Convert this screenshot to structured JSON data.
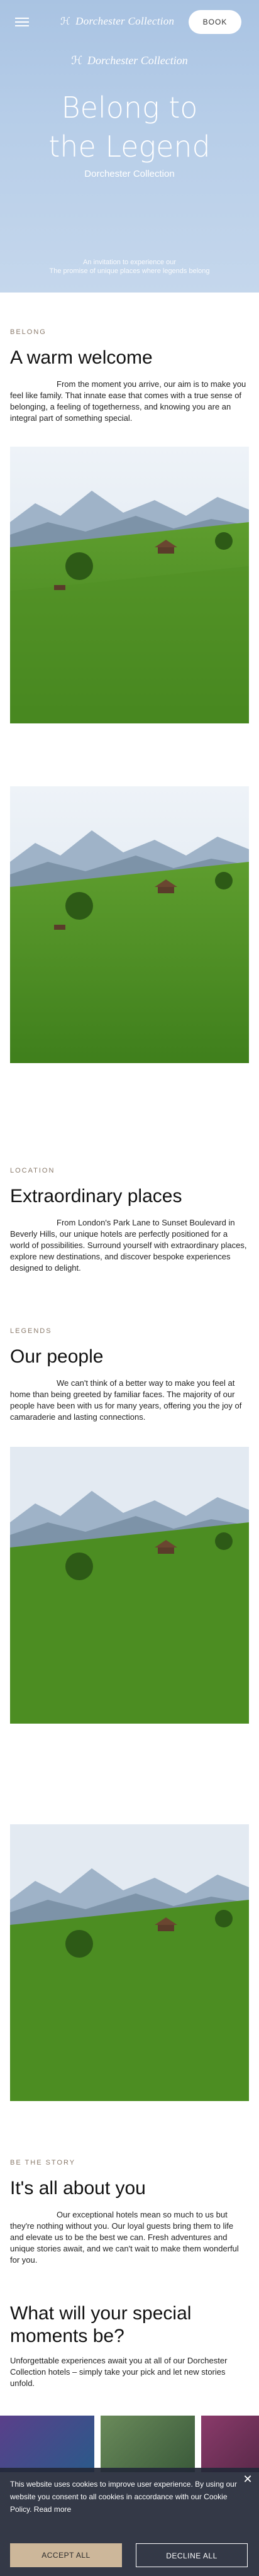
{
  "header": {
    "brand": "Dorchester Collection",
    "book_label": "BOOK"
  },
  "hero": {
    "brand": "Dorchester Collection",
    "title_line1": "Belong to",
    "title_line2": "the Legend",
    "subtitle": "Dorchester Collection",
    "footer_line1": "An invitation to experience our ",
    "footer_line2": "The promise of unique places where legends belong"
  },
  "welcome": {
    "eyebrow": "BELONG",
    "title": "A warm welcome",
    "body": "From the moment you arrive, our aim is to make you feel like family. That innate ease that comes with a true sense of belonging, a feeling of togetherness, and knowing you are an integral part of something special."
  },
  "places": {
    "eyebrow": "LOCATION",
    "title": "Extraordinary places",
    "body": "From London's Park Lane to Sunset Boulevard in Beverly Hills, our unique hotels are perfectly positioned for a world of possibilities. Surround yourself with extraordinary places, explore new destinations, and discover bespoke experiences designed to delight."
  },
  "people": {
    "eyebrow": "LEGENDS",
    "title": "Our people",
    "body": "We can't think of a better way to make you feel at home than being greeted by familiar faces. The majority of our people have been with us for many years, offering you the joy of camaraderie and lasting connections."
  },
  "story": {
    "eyebrow": "BE THE STORY",
    "title": "It's all about you",
    "body": "Our exceptional hotels mean so much to us but they're nothing without you. Our loyal guests bring them to life and elevate us to be the best we can. Fresh adventures and unique stories await, and we can't wait to make them wonderful for you."
  },
  "moments": {
    "title": "What will your special moments be?",
    "body": "Unforgettable experiences await you at all of our Dorchester Collection hotels – simply take your pick and let new stories unfold."
  },
  "cookie": {
    "text": "This website uses cookies to improve user experience. By using our website you consent to all cookies in accordance with our Cookie Policy.",
    "read_more": "Read more",
    "accept_label": "ACCEPT ALL",
    "decline_label": "DECLINE ALL",
    "close_glyph": "✕"
  },
  "colors": {
    "hero_sky": "#b6cde8",
    "eyebrow": "#8a7a6b",
    "accept": "#cdb79a",
    "banner": "#232837"
  }
}
